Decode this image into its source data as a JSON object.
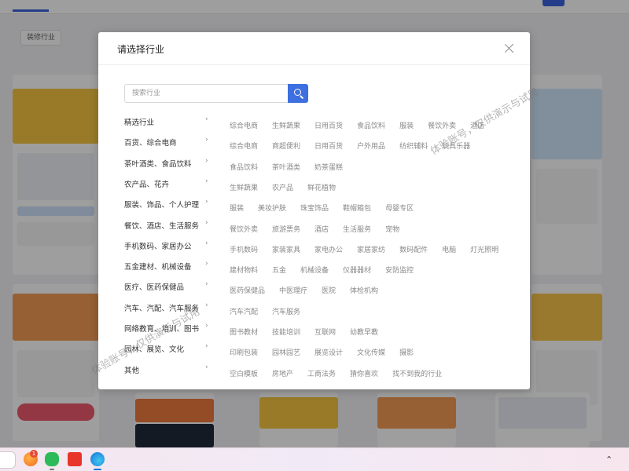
{
  "background": {
    "tag_label": "装修行业"
  },
  "modal": {
    "title": "请选择行业",
    "search_placeholder": "搜索行业",
    "rows": [
      {
        "label": "精选行业",
        "items": [
          "综合电商",
          "生鲜蔬果",
          "日用百货",
          "食品饮料",
          "服装",
          "餐饮外卖",
          "酒店"
        ]
      },
      {
        "label": "百货、综合电商",
        "items": [
          "综合电商",
          "商超便利",
          "日用百货",
          "户外用品",
          "纺织辅料",
          "玩具乐器"
        ]
      },
      {
        "label": "茶叶酒类、食品饮料",
        "items": [
          "食品饮料",
          "茶叶酒类",
          "奶茶蛋糕"
        ]
      },
      {
        "label": "农产品、花卉",
        "items": [
          "生鲜蔬果",
          "农产品",
          "鲜花植物"
        ]
      },
      {
        "label": "服装、饰品、个人护理",
        "items": [
          "服装",
          "美妆护肤",
          "珠宝饰品",
          "鞋帽箱包",
          "母婴专区"
        ]
      },
      {
        "label": "餐饮、酒店、生活服务",
        "items": [
          "餐饮外卖",
          "旅游票务",
          "酒店",
          "生活服务",
          "宠物"
        ]
      },
      {
        "label": "手机数码、家居办公",
        "items": [
          "手机数码",
          "家装家具",
          "家电办公",
          "家居家纺",
          "数码配件",
          "电脑",
          "灯光照明"
        ]
      },
      {
        "label": "五金建材、机械设备",
        "items": [
          "建材物料",
          "五金",
          "机械设备",
          "仪器器材",
          "安防监控"
        ]
      },
      {
        "label": "医疗、医药保健品",
        "items": [
          "医药保健品",
          "中医理疗",
          "医院",
          "体检机构"
        ]
      },
      {
        "label": "汽车、汽配、汽车服务",
        "items": [
          "汽车汽配",
          "汽车服务"
        ]
      },
      {
        "label": "网络教育、培训、图书",
        "items": [
          "图书教材",
          "技能培训",
          "互联网",
          "幼教早教"
        ]
      },
      {
        "label": "园林、展览、文化",
        "items": [
          "印刷包装",
          "园林园艺",
          "展览设计",
          "文化传媒",
          "摄影"
        ]
      },
      {
        "label": "其他",
        "items": [
          "空白模板",
          "房地产",
          "工商法务",
          "猜你喜欢",
          "找不到我的行业"
        ]
      }
    ]
  },
  "watermarks": [
    {
      "text": "体验账号，仅供演示与试用"
    },
    {
      "text": "体验账号，仅供演示与试用"
    }
  ],
  "taskbar": {
    "badge_count": "1",
    "icons": [
      "browser-orange-icon",
      "wechat-icon",
      "wps-icon",
      "edge-icon"
    ]
  },
  "colors": {
    "accent": "#3d6fe0",
    "category_text": "#333333",
    "sub_text": "#8a8a8a"
  }
}
